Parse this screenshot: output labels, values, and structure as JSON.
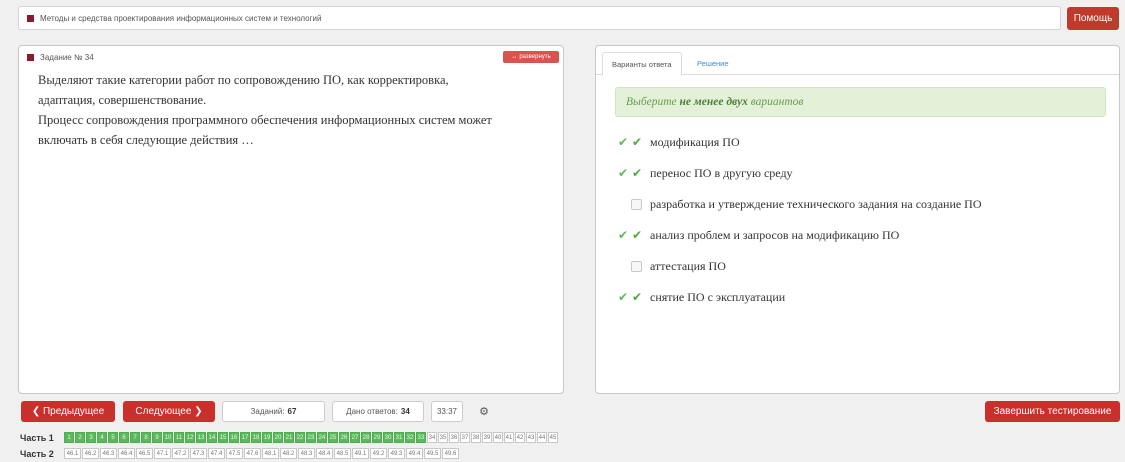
{
  "header": {
    "course_title": "Методы и средства проектирования информационных систем и технологий",
    "help_label": "Помощь"
  },
  "question": {
    "label": "Задание № 34",
    "expand_label": "развернуть",
    "text_lines": [
      "Выделяют такие категории работ по сопровождению ПО, как корректировка,",
      "адаптация, совершенствование.",
      "Процесс сопровождения программного обеспечения информационных систем может",
      "включать в себя следующие действия …"
    ]
  },
  "answer": {
    "tab_active": "Варианты ответа",
    "tab_other": "Решение",
    "hint_pre": "Выберите",
    "hint_bold": "не менее двух",
    "hint_post": "вариантов",
    "options": [
      {
        "text": "модификация ПО",
        "checked": true,
        "correct": true
      },
      {
        "text": "перенос ПО в другую среду",
        "checked": true,
        "correct": true
      },
      {
        "text": "разработка и утверждение технического задания на создание  ПО",
        "checked": false,
        "correct": false
      },
      {
        "text": "анализ проблем и запросов на модификацию ПО",
        "checked": true,
        "correct": true
      },
      {
        "text": "аттестация ПО",
        "checked": false,
        "correct": false
      },
      {
        "text": "снятие ПО с эксплуатации",
        "checked": true,
        "correct": true
      }
    ]
  },
  "footer": {
    "prev_label": "Предыдущее",
    "next_label": "Следующее",
    "tasks_label": "Заданий:",
    "tasks_value": "67",
    "answered_label": "Дано ответов:",
    "answered_value": "34",
    "timer": "33:37",
    "finish_label": "Завершить тестирование"
  },
  "parts": [
    {
      "label": "Часть 1",
      "cells": [
        "1",
        "2",
        "3",
        "4",
        "5",
        "6",
        "7",
        "8",
        "9",
        "10",
        "11",
        "12",
        "13",
        "14",
        "15",
        "16",
        "17",
        "18",
        "19",
        "20",
        "21",
        "22",
        "23",
        "24",
        "25",
        "26",
        "27",
        "28",
        "29",
        "30",
        "31",
        "32",
        "33",
        "34",
        "35",
        "36",
        "37",
        "38",
        "39",
        "40",
        "41",
        "42",
        "43",
        "44",
        "45"
      ],
      "done_count": 33
    },
    {
      "label": "Часть 2",
      "cells": [
        "46.1",
        "46.2",
        "46.3",
        "46.4",
        "46.5",
        "47.1",
        "47.2",
        "47.3",
        "47.4",
        "47.5",
        "47.6",
        "48.1",
        "48.2",
        "48.3",
        "48.4",
        "48.5",
        "49.1",
        "49.2",
        "49.3",
        "49.4",
        "49.5",
        "49.6"
      ],
      "done_count": 0
    }
  ],
  "colors": {
    "accent": "#c9302c",
    "done": "#5cb85c",
    "hint_bg": "#e3f1d8",
    "link": "#3a8fd9"
  }
}
